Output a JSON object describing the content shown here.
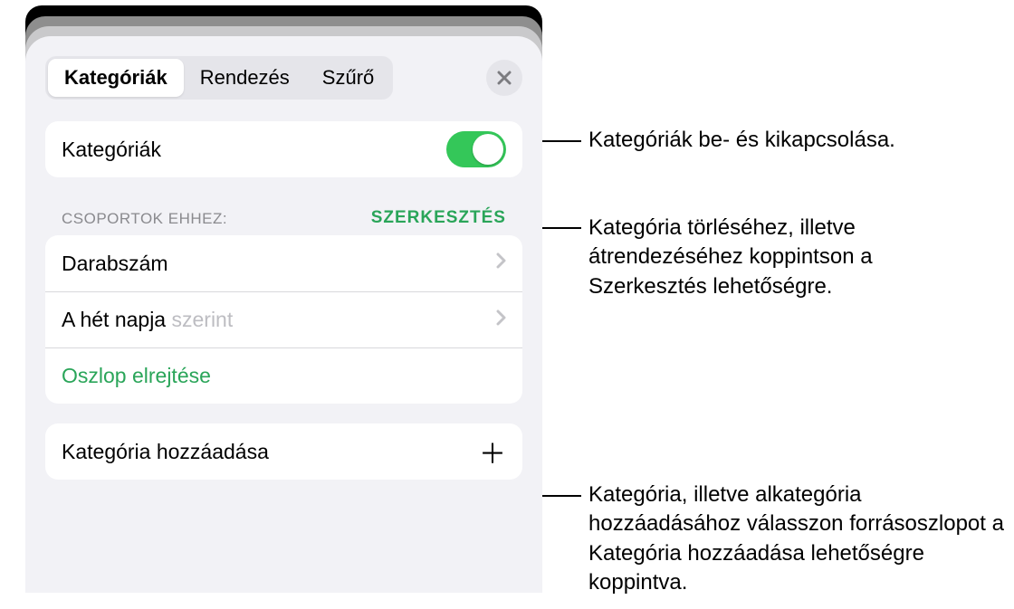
{
  "tabs": {
    "categories": "Kategóriák",
    "sort": "Rendezés",
    "filter": "Szűrő"
  },
  "toggleRow": {
    "label": "Kategóriák"
  },
  "groupsHeader": {
    "title": "CSOPORTOK EHHEZ:",
    "edit": "SZERKESZTÉS"
  },
  "groupList": {
    "row1": "Darabszám",
    "row2a": "A hét napja ",
    "row2b": "szerint",
    "hide": "Oszlop elrejtése"
  },
  "addRow": {
    "label": "Kategória hozzáadása"
  },
  "callouts": {
    "c1": "Kategóriák be- és kikapcsolása.",
    "c2": "Kategória törléséhez, illetve átrendezéséhez koppintson a Szerkesztés lehetőségre.",
    "c3": "Kategória, illetve alkategória hozzáadásához válasszon forrásoszlopot a Kategória hozzáadása lehetőségre koppintva."
  }
}
